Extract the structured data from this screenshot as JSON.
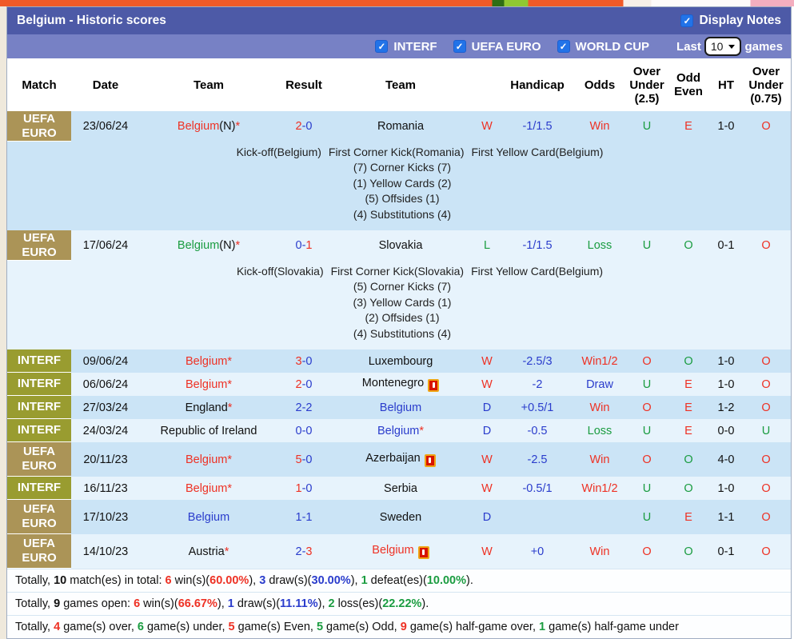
{
  "page": {
    "title": "Belgium - Historic scores",
    "display_notes_label": "Display Notes"
  },
  "colors": {
    "win_red": "#ee3124",
    "loss_green": "#1a9c40",
    "draw_blue": "#2a3ccc",
    "title_bar": "#4d5aa7",
    "filter_bar": "#7781c5",
    "badge_euro": "#ab9457",
    "badge_interf": "#999c30",
    "row_dark": "#cbe4f6",
    "row_light": "#e7f3fc",
    "checkbox_blue": "#2273e8"
  },
  "filters": {
    "competitions": [
      {
        "label": "INTERF",
        "checked": true
      },
      {
        "label": "UEFA EURO",
        "checked": true
      },
      {
        "label": "WORLD CUP",
        "checked": true
      }
    ],
    "last_label": "Last",
    "games_count": "10",
    "games_label": "games"
  },
  "table": {
    "headers": [
      {
        "lines": [
          "Match"
        ]
      },
      {
        "lines": [
          "Date"
        ]
      },
      {
        "lines": [
          "Team"
        ]
      },
      {
        "lines": [
          "Result"
        ]
      },
      {
        "lines": [
          "Team"
        ]
      },
      {
        "lines": []
      },
      {
        "lines": [
          "Handicap"
        ]
      },
      {
        "lines": [
          "Odds"
        ]
      },
      {
        "lines": [
          "Over",
          "Under",
          "(2.5)"
        ]
      },
      {
        "lines": [
          "Odd",
          "Even"
        ]
      },
      {
        "lines": [
          "HT"
        ]
      },
      {
        "lines": [
          "Over",
          "Under",
          "(0.75)"
        ]
      }
    ],
    "rows": [
      {
        "league": {
          "label_lines": [
            "UEFA",
            "EURO"
          ],
          "type": "euro"
        },
        "date": "23/06/24",
        "home": {
          "name": "Belgium",
          "suffix": "(N)",
          "star": true,
          "color": "red",
          "card": false
        },
        "score": {
          "home": "2",
          "away": "0",
          "home_color": "red",
          "away_color": "blue"
        },
        "away": {
          "name": "Romania",
          "color": "black",
          "star": false,
          "card": false
        },
        "wdl": {
          "text": "W",
          "color": "red"
        },
        "handicap": "-1/1.5",
        "odds": {
          "text": "Win",
          "color": "red"
        },
        "over_under_25": {
          "text": "U",
          "color": "green"
        },
        "odd_even": {
          "text": "E",
          "color": "red"
        },
        "ht": "1-0",
        "over_under_075": {
          "text": "O",
          "color": "red"
        },
        "size": "lg",
        "shade": "dark",
        "notes": {
          "headline": [
            "Kick-off(Belgium)",
            "First Corner Kick(Romania)",
            "First Yellow Card(Belgium)"
          ],
          "stats": [
            "(7) Corner Kicks (7)",
            "(1) Yellow Cards (2)",
            "(5) Offsides (1)",
            "(4) Substitutions (4)"
          ]
        }
      },
      {
        "league": {
          "label_lines": [
            "UEFA",
            "EURO"
          ],
          "type": "euro"
        },
        "date": "17/06/24",
        "home": {
          "name": "Belgium",
          "suffix": "(N)",
          "star": true,
          "color": "green",
          "card": false
        },
        "score": {
          "home": "0",
          "away": "1",
          "home_color": "blue",
          "away_color": "red"
        },
        "away": {
          "name": "Slovakia",
          "color": "black",
          "star": false,
          "card": false
        },
        "wdl": {
          "text": "L",
          "color": "green"
        },
        "handicap": "-1/1.5",
        "odds": {
          "text": "Loss",
          "color": "green"
        },
        "over_under_25": {
          "text": "U",
          "color": "green"
        },
        "odd_even": {
          "text": "O",
          "color": "green"
        },
        "ht": "0-1",
        "over_under_075": {
          "text": "O",
          "color": "red"
        },
        "size": "lg",
        "shade": "light",
        "notes": {
          "headline": [
            "Kick-off(Slovakia)",
            "First Corner Kick(Slovakia)",
            "First Yellow Card(Belgium)"
          ],
          "stats": [
            "(5) Corner Kicks (7)",
            "(3) Yellow Cards (1)",
            "(2) Offsides (1)",
            "(4) Substitutions (4)"
          ]
        }
      },
      {
        "league": {
          "label_lines": [
            "INTERF"
          ],
          "type": "interf"
        },
        "date": "09/06/24",
        "home": {
          "name": "Belgium",
          "star": true,
          "color": "red",
          "card": false
        },
        "score": {
          "home": "3",
          "away": "0",
          "home_color": "red",
          "away_color": "blue"
        },
        "away": {
          "name": "Luxembourg",
          "color": "black",
          "star": false,
          "card": false
        },
        "wdl": {
          "text": "W",
          "color": "red"
        },
        "handicap": "-2.5/3",
        "odds": {
          "text": "Win1/2",
          "color": "red"
        },
        "over_under_25": {
          "text": "O",
          "color": "red"
        },
        "odd_even": {
          "text": "O",
          "color": "green"
        },
        "ht": "1-0",
        "over_under_075": {
          "text": "O",
          "color": "red"
        },
        "size": "sm",
        "shade": "dark",
        "notes": null
      },
      {
        "league": {
          "label_lines": [
            "INTERF"
          ],
          "type": "interf"
        },
        "date": "06/06/24",
        "home": {
          "name": "Belgium",
          "star": true,
          "color": "red",
          "card": false
        },
        "score": {
          "home": "2",
          "away": "0",
          "home_color": "red",
          "away_color": "blue"
        },
        "away": {
          "name": "Montenegro",
          "color": "black",
          "star": false,
          "card": true
        },
        "wdl": {
          "text": "W",
          "color": "red"
        },
        "handicap": "-2",
        "odds": {
          "text": "Draw",
          "color": "blue"
        },
        "over_under_25": {
          "text": "U",
          "color": "green"
        },
        "odd_even": {
          "text": "E",
          "color": "red"
        },
        "ht": "1-0",
        "over_under_075": {
          "text": "O",
          "color": "red"
        },
        "size": "sm",
        "shade": "light",
        "notes": null
      },
      {
        "league": {
          "label_lines": [
            "INTERF"
          ],
          "type": "interf"
        },
        "date": "27/03/24",
        "home": {
          "name": "England",
          "star": true,
          "color": "black",
          "card": false
        },
        "score": {
          "home": "2",
          "away": "2",
          "home_color": "blue",
          "away_color": "blue"
        },
        "away": {
          "name": "Belgium",
          "color": "blue",
          "star": false,
          "card": false
        },
        "wdl": {
          "text": "D",
          "color": "blue"
        },
        "handicap": "+0.5/1",
        "odds": {
          "text": "Win",
          "color": "red"
        },
        "over_under_25": {
          "text": "O",
          "color": "red"
        },
        "odd_even": {
          "text": "E",
          "color": "red"
        },
        "ht": "1-2",
        "over_under_075": {
          "text": "O",
          "color": "red"
        },
        "size": "sm",
        "shade": "dark",
        "notes": null
      },
      {
        "league": {
          "label_lines": [
            "INTERF"
          ],
          "type": "interf"
        },
        "date": "24/03/24",
        "home": {
          "name": "Republic of Ireland",
          "star": false,
          "color": "black",
          "card": false
        },
        "score": {
          "home": "0",
          "away": "0",
          "home_color": "blue",
          "away_color": "blue"
        },
        "away": {
          "name": "Belgium",
          "color": "blue",
          "star": true,
          "card": false
        },
        "wdl": {
          "text": "D",
          "color": "blue"
        },
        "handicap": "-0.5",
        "odds": {
          "text": "Loss",
          "color": "green"
        },
        "over_under_25": {
          "text": "U",
          "color": "green"
        },
        "odd_even": {
          "text": "E",
          "color": "red"
        },
        "ht": "0-0",
        "over_under_075": {
          "text": "U",
          "color": "green"
        },
        "size": "sm",
        "shade": "light",
        "notes": null
      },
      {
        "league": {
          "label_lines": [
            "UEFA",
            "EURO"
          ],
          "type": "euro"
        },
        "date": "20/11/23",
        "home": {
          "name": "Belgium",
          "star": true,
          "color": "red",
          "card": false
        },
        "score": {
          "home": "5",
          "away": "0",
          "home_color": "red",
          "away_color": "blue"
        },
        "away": {
          "name": "Azerbaijan",
          "color": "black",
          "star": false,
          "card": true
        },
        "wdl": {
          "text": "W",
          "color": "red"
        },
        "handicap": "-2.5",
        "odds": {
          "text": "Win",
          "color": "red"
        },
        "over_under_25": {
          "text": "O",
          "color": "red"
        },
        "odd_even": {
          "text": "O",
          "color": "green"
        },
        "ht": "4-0",
        "over_under_075": {
          "text": "O",
          "color": "red"
        },
        "size": "md",
        "shade": "dark",
        "notes": null
      },
      {
        "league": {
          "label_lines": [
            "INTERF"
          ],
          "type": "interf"
        },
        "date": "16/11/23",
        "home": {
          "name": "Belgium",
          "star": true,
          "color": "red",
          "card": false
        },
        "score": {
          "home": "1",
          "away": "0",
          "home_color": "red",
          "away_color": "blue"
        },
        "away": {
          "name": "Serbia",
          "color": "black",
          "star": false,
          "card": false
        },
        "wdl": {
          "text": "W",
          "color": "red"
        },
        "handicap": "-0.5/1",
        "odds": {
          "text": "Win1/2",
          "color": "red"
        },
        "over_under_25": {
          "text": "U",
          "color": "green"
        },
        "odd_even": {
          "text": "O",
          "color": "green"
        },
        "ht": "1-0",
        "over_under_075": {
          "text": "O",
          "color": "red"
        },
        "size": "sm",
        "shade": "light",
        "notes": null
      },
      {
        "league": {
          "label_lines": [
            "UEFA",
            "EURO"
          ],
          "type": "euro"
        },
        "date": "17/10/23",
        "home": {
          "name": "Belgium",
          "star": false,
          "color": "blue",
          "card": false
        },
        "score": {
          "home": "1",
          "away": "1",
          "home_color": "blue",
          "away_color": "blue"
        },
        "away": {
          "name": "Sweden",
          "color": "black",
          "star": false,
          "card": false
        },
        "wdl": {
          "text": "D",
          "color": "blue"
        },
        "handicap": "",
        "odds": {
          "text": "",
          "color": "black"
        },
        "over_under_25": {
          "text": "U",
          "color": "green"
        },
        "odd_even": {
          "text": "E",
          "color": "red"
        },
        "ht": "1-1",
        "over_under_075": {
          "text": "O",
          "color": "red"
        },
        "size": "md",
        "shade": "dark",
        "notes": null
      },
      {
        "league": {
          "label_lines": [
            "UEFA",
            "EURO"
          ],
          "type": "euro"
        },
        "date": "14/10/23",
        "home": {
          "name": "Austria",
          "star": true,
          "color": "black",
          "card": false
        },
        "score": {
          "home": "2",
          "away": "3",
          "home_color": "blue",
          "away_color": "red"
        },
        "away": {
          "name": "Belgium",
          "color": "red",
          "star": false,
          "card": true
        },
        "wdl": {
          "text": "W",
          "color": "red"
        },
        "handicap": "+0",
        "odds": {
          "text": "Win",
          "color": "red"
        },
        "over_under_25": {
          "text": "O",
          "color": "red"
        },
        "odd_even": {
          "text": "O",
          "color": "green"
        },
        "ht": "0-1",
        "over_under_075": {
          "text": "O",
          "color": "red"
        },
        "size": "md",
        "shade": "light",
        "notes": null
      }
    ]
  },
  "summary": [
    {
      "parts": [
        {
          "t": "Totally, "
        },
        {
          "t": "10",
          "b": true
        },
        {
          "t": " match(es) in total: "
        },
        {
          "t": "6",
          "b": true,
          "c": "red"
        },
        {
          "t": " win(s)("
        },
        {
          "t": "60.00%",
          "b": true,
          "c": "red"
        },
        {
          "t": "), "
        },
        {
          "t": "3",
          "b": true,
          "c": "blue"
        },
        {
          "t": " draw(s)("
        },
        {
          "t": "30.00%",
          "b": true,
          "c": "blue"
        },
        {
          "t": "), "
        },
        {
          "t": "1",
          "b": true,
          "c": "green"
        },
        {
          "t": " defeat(es)("
        },
        {
          "t": "10.00%",
          "b": true,
          "c": "green"
        },
        {
          "t": ")."
        }
      ]
    },
    {
      "parts": [
        {
          "t": "Totally, "
        },
        {
          "t": "9",
          "b": true
        },
        {
          "t": " games open: "
        },
        {
          "t": "6",
          "b": true,
          "c": "red"
        },
        {
          "t": " win(s)("
        },
        {
          "t": "66.67%",
          "b": true,
          "c": "red"
        },
        {
          "t": "), "
        },
        {
          "t": "1",
          "b": true,
          "c": "blue"
        },
        {
          "t": " draw(s)("
        },
        {
          "t": "11.11%",
          "b": true,
          "c": "blue"
        },
        {
          "t": "), "
        },
        {
          "t": "2",
          "b": true,
          "c": "green"
        },
        {
          "t": " loss(es)("
        },
        {
          "t": "22.22%",
          "b": true,
          "c": "green"
        },
        {
          "t": ")."
        }
      ]
    },
    {
      "parts": [
        {
          "t": "Totally, "
        },
        {
          "t": "4",
          "b": true,
          "c": "red"
        },
        {
          "t": " game(s) over, "
        },
        {
          "t": "6",
          "b": true,
          "c": "green"
        },
        {
          "t": " game(s) under, "
        },
        {
          "t": "5",
          "b": true,
          "c": "red"
        },
        {
          "t": " game(s) Even, "
        },
        {
          "t": "5",
          "b": true,
          "c": "green"
        },
        {
          "t": " game(s) Odd, "
        },
        {
          "t": "9",
          "b": true,
          "c": "red"
        },
        {
          "t": " game(s) half-game over, "
        },
        {
          "t": "1",
          "b": true,
          "c": "green"
        },
        {
          "t": " game(s) half-game under"
        }
      ]
    }
  ]
}
